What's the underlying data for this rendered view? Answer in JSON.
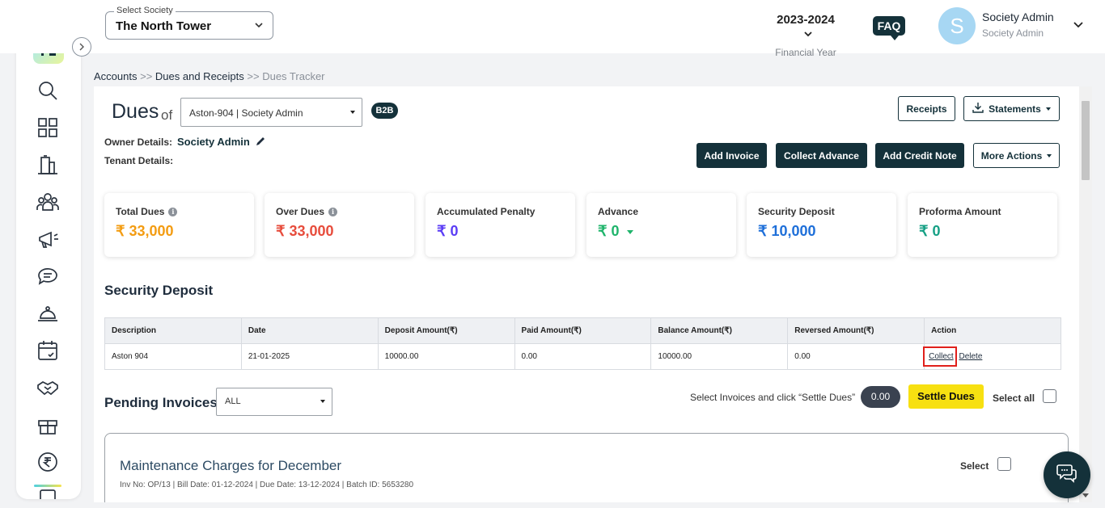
{
  "header": {
    "society_legend": "Select Society",
    "society_value": "The North Tower",
    "financial_year": "2023-2024",
    "financial_year_label": "Financial Year",
    "faq_label": "FAQ",
    "avatar_letter": "S",
    "user_name": "Society Admin",
    "user_role": "Society Admin"
  },
  "breadcrumb": {
    "items": [
      "Accounts",
      "Dues and Receipts",
      "Dues Tracker"
    ],
    "separator": ">>"
  },
  "dues": {
    "title": "Dues",
    "of": "of",
    "unit_value": "Aston-904 | Society Admin",
    "badge": "B2B",
    "owner_label": "Owner Details:",
    "owner_value": "Society Admin",
    "tenant_label": "Tenant Details:"
  },
  "buttons": {
    "receipts": "Receipts",
    "statements": "Statements",
    "add_invoice": "Add Invoice",
    "collect_advance": "Collect Advance",
    "add_credit_note": "Add Credit Note",
    "more_actions": "More Actions"
  },
  "cards": [
    {
      "label": "Total Dues",
      "value": "₹ 33,000",
      "color": "#f39c12",
      "info": true
    },
    {
      "label": "Over Dues",
      "value": "₹ 33,000",
      "color": "#e74c3c",
      "info": true
    },
    {
      "label": "Accumulated Penalty",
      "value": "₹ 0",
      "color": "#5b3df5",
      "info": false
    },
    {
      "label": "Advance",
      "value": "₹ 0",
      "color": "#1fb46b",
      "info": false
    },
    {
      "label": "Security Deposit",
      "value": "₹ 10,000",
      "color": "#1e6fd9",
      "info": false
    },
    {
      "label": "Proforma Amount",
      "value": "₹ 0",
      "color": "#16a085",
      "info": false
    }
  ],
  "security_deposit": {
    "title": "Security Deposit",
    "columns": [
      "Description",
      "Date",
      "Deposit Amount(₹)",
      "Paid Amount(₹)",
      "Balance Amount(₹)",
      "Reversed Amount(₹)",
      "Action"
    ],
    "rows": [
      {
        "description": "Aston 904",
        "date": "21-01-2025",
        "deposit": "10000.00",
        "paid": "0.00",
        "balance": "10000.00",
        "reversed": "0.00",
        "collect": "Collect",
        "delete": "Delete"
      }
    ]
  },
  "pending": {
    "title": "Pending Invoices",
    "filter_value": "ALL",
    "hint": "Select Invoices and click “Settle Dues”",
    "amount": "0.00",
    "settle_label": "Settle Dues",
    "select_all_label": "Select all",
    "invoice": {
      "title": "Maintenance Charges for December",
      "meta": "Inv No: OP/13 | Bill Date: 01-12-2024 | Due Date: 13-12-2024 | Batch ID: 5653280",
      "select_label": "Select"
    }
  },
  "icons": {
    "sidebar": [
      "search-icon",
      "dashboard-icon",
      "building-icon",
      "members-icon",
      "announcement-icon",
      "chat-icon",
      "helpdesk-icon",
      "calendar-icon",
      "handshake-icon",
      "gift-icon",
      "rupee-icon",
      "document-icon"
    ]
  }
}
